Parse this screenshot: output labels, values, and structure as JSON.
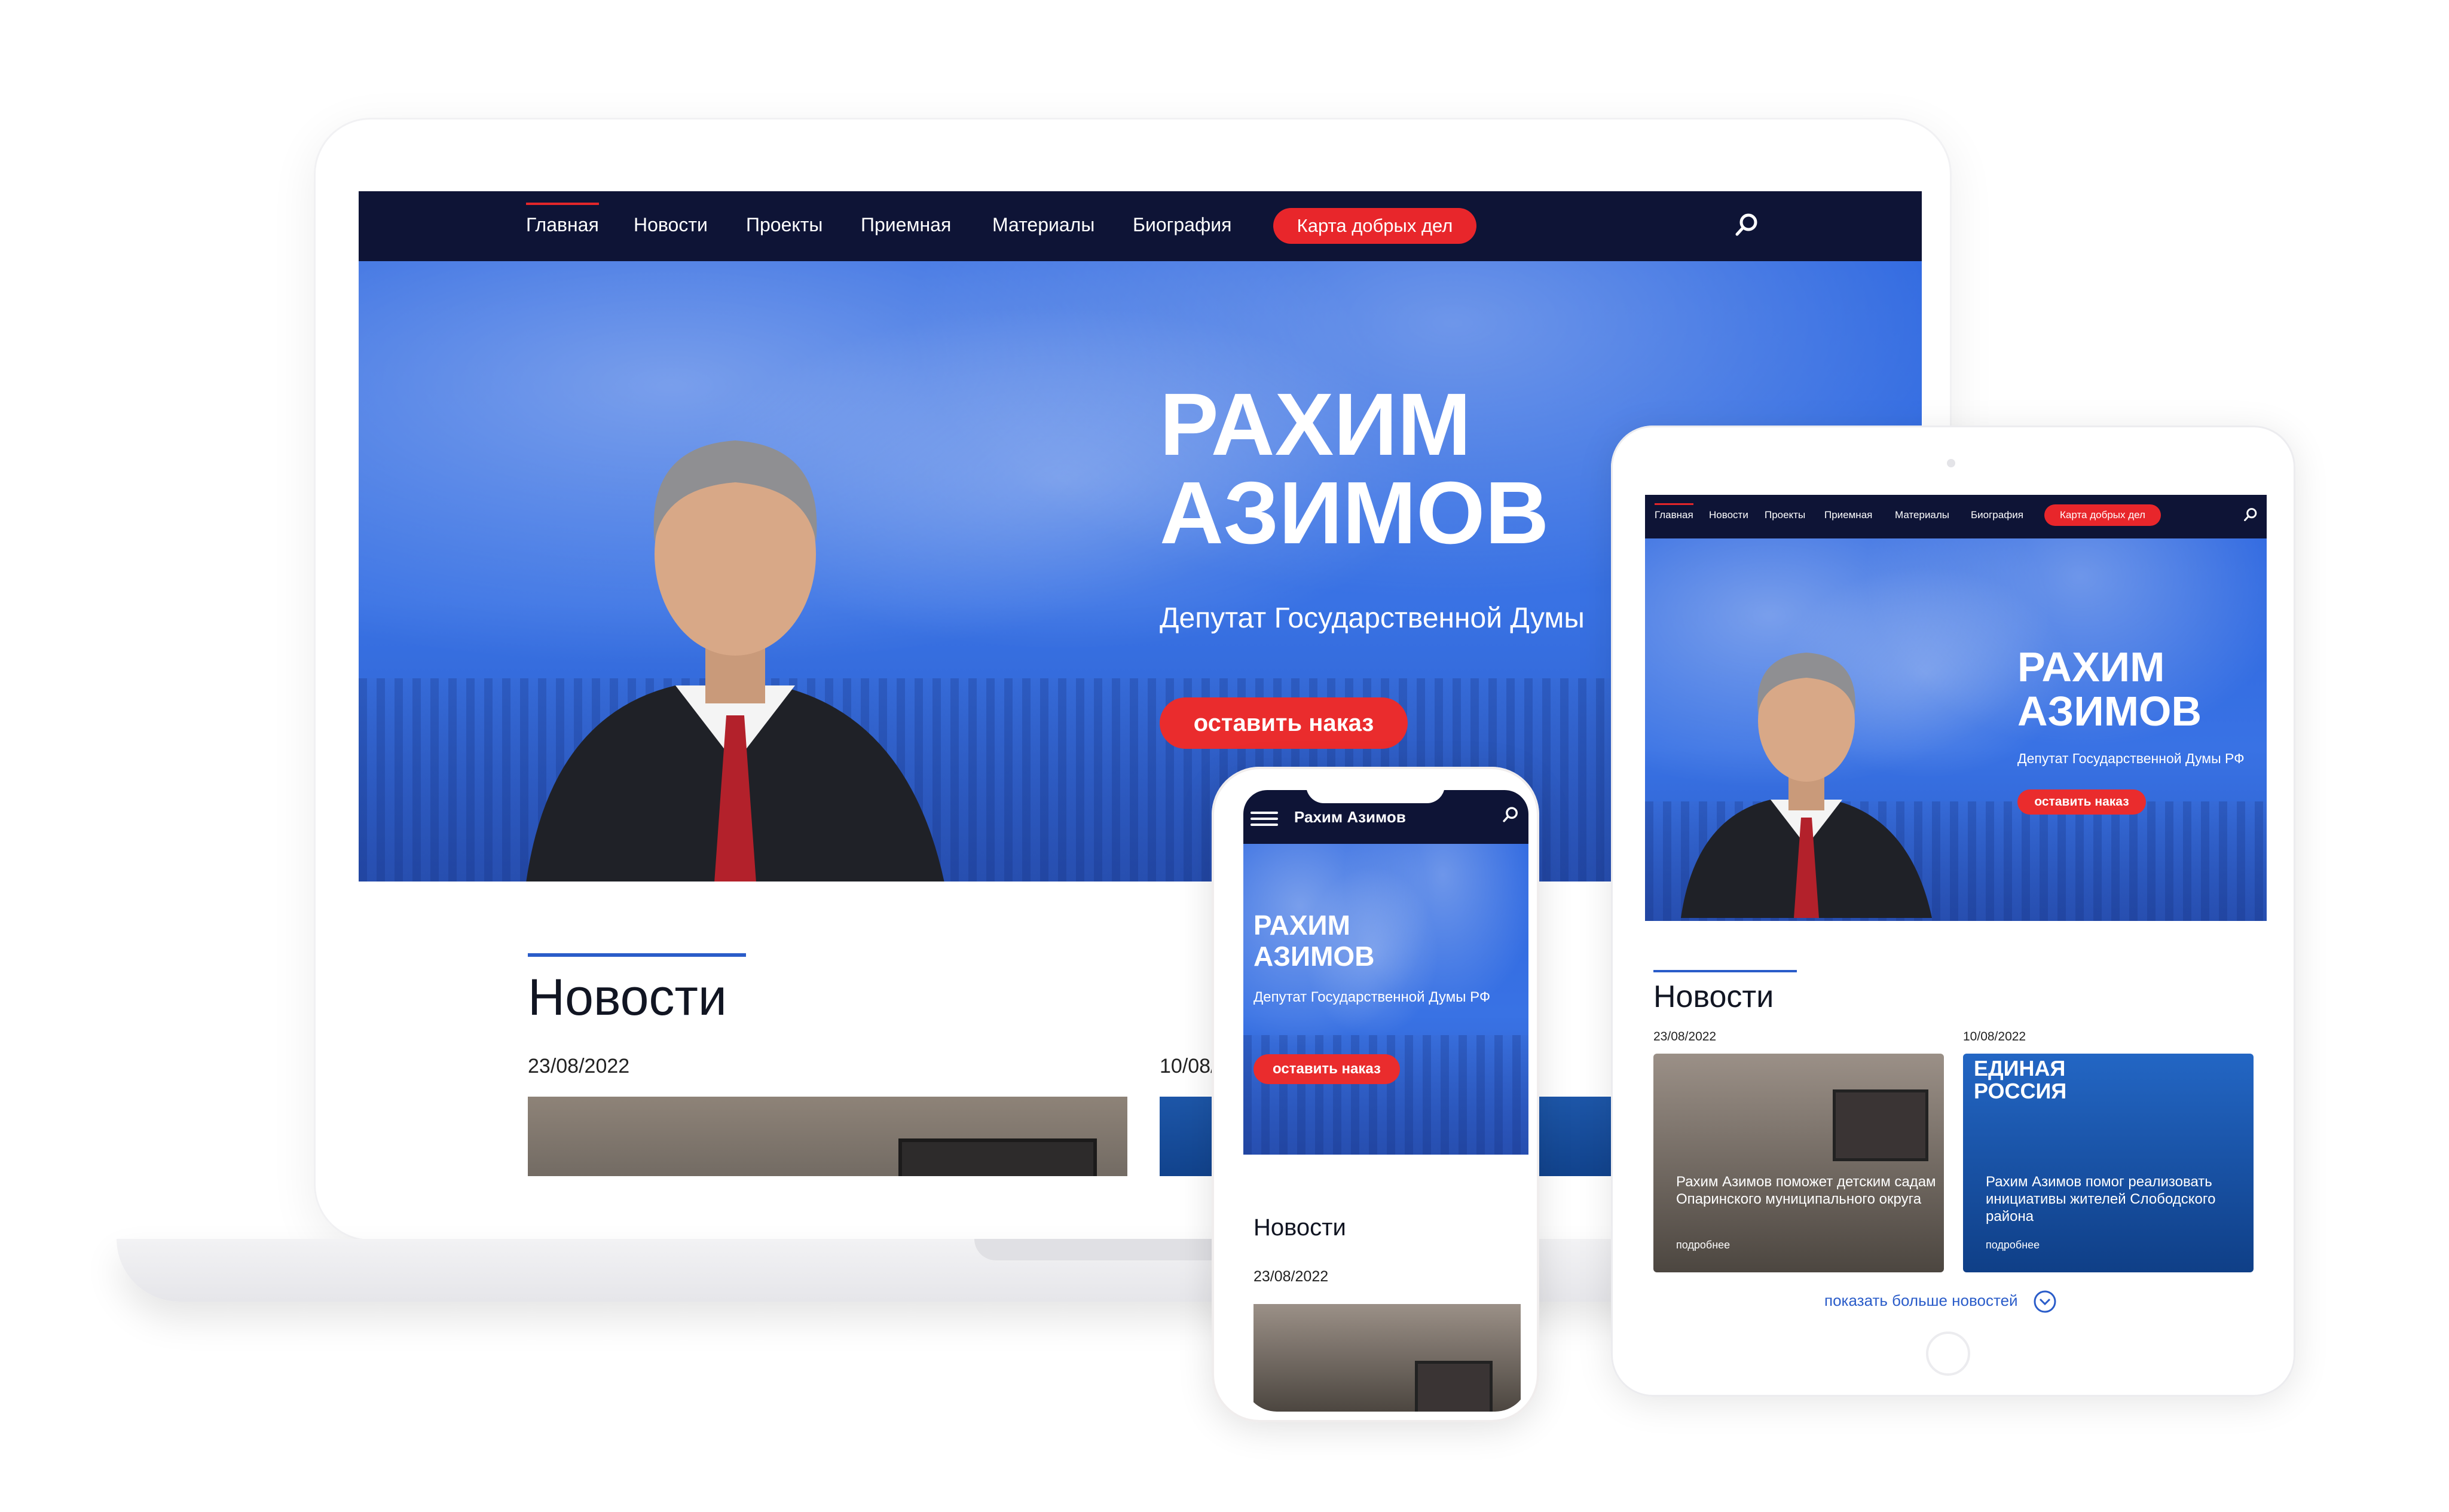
{
  "site": {
    "nav": [
      "Главная",
      "Новости",
      "Проекты",
      "Приемная",
      "Материалы",
      "Биография"
    ],
    "nav_highlight": "Карта добрых дел",
    "name_lines": "РАХИМ\nАЗИМОВ",
    "subtitle": "Депутат Государственной Думы РФ",
    "subtitle_cut": "Депутат Государственной Думы",
    "cta": "оставить наказ",
    "news_heading": "Новости",
    "show_more": "показать больше новостей",
    "more_label": "подробнее",
    "mobile_brand": "Рахим Азимов",
    "news": [
      {
        "date": "23/08/2022",
        "title": "Рахим Азимов поможет детским садам Опаринского муниципального округа"
      },
      {
        "date": "10/08/2022",
        "title": "Рахим Азимов помог реализовать инициативы жителей Слободского района"
      }
    ],
    "partial_date": "10/08/",
    "party_sign": "ЕДИНАЯ РОССИЯ"
  },
  "colors": {
    "nav_bg": "#0e1436",
    "accent_red": "#e8262b",
    "hero_blue": "#2d67e0",
    "news_rule": "#2a5cc9"
  },
  "icons": [
    "search-icon",
    "menu-icon",
    "chevron-down-circle-icon"
  ]
}
